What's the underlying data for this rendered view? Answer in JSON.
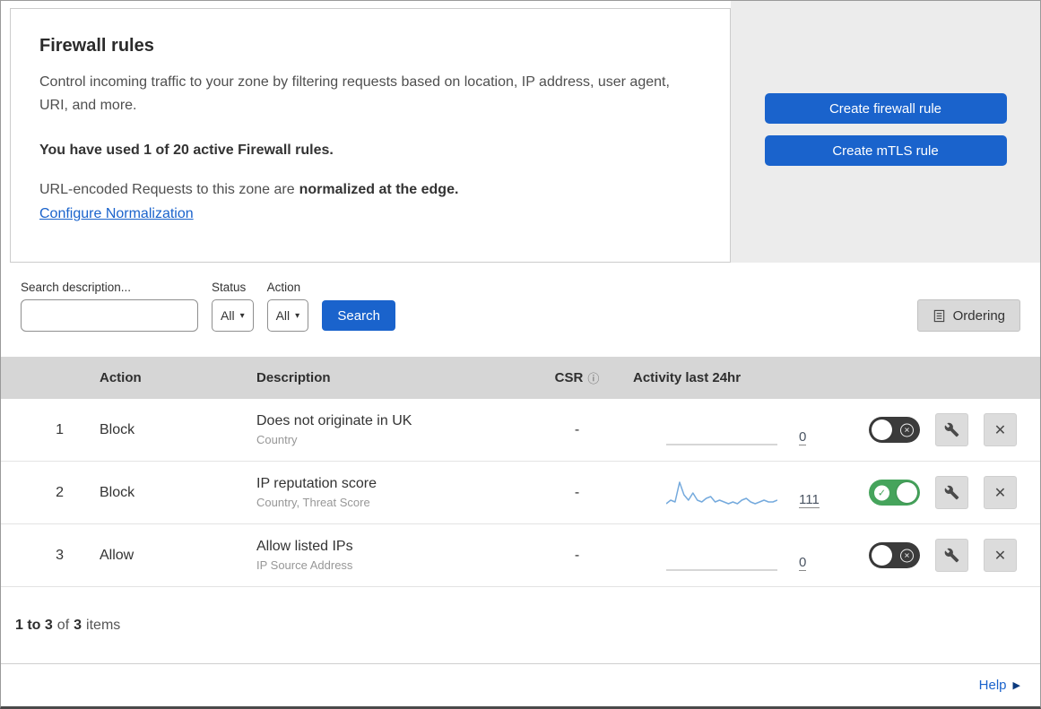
{
  "page": {
    "title": "Firewall rules",
    "description": "Control incoming traffic to your zone by filtering requests based on location, IP address, user agent, URI, and more.",
    "usage_text": "You have used 1 of 20 active Firewall rules.",
    "normalization_prefix": "URL-encoded Requests to this zone are",
    "normalization_bold": "normalized at the edge.",
    "normalization_link": "Configure Normalization"
  },
  "actions_panel": {
    "create_firewall_rule": "Create firewall rule",
    "create_mtls_rule": "Create mTLS rule"
  },
  "toolbar": {
    "search_label": "Search description...",
    "status": {
      "label": "Status",
      "value": "All"
    },
    "action": {
      "label": "Action",
      "value": "All"
    },
    "search_button": "Search",
    "ordering_button": "Ordering"
  },
  "table": {
    "headers": {
      "action": "Action",
      "description": "Description",
      "csr": "CSR",
      "activity": "Activity last 24hr"
    },
    "rows": [
      {
        "priority": "1",
        "action": "Block",
        "description": "Does not originate in UK",
        "match_fields": "Country",
        "csr": "-",
        "activity_count": "0",
        "enabled": false,
        "sparkline": [
          0,
          0,
          0,
          0,
          0,
          0,
          0,
          0,
          0,
          0,
          0,
          0
        ]
      },
      {
        "priority": "2",
        "action": "Block",
        "description": "IP reputation score",
        "match_fields": "Country, Threat Score",
        "csr": "-",
        "activity_count": "111",
        "enabled": true,
        "sparkline": [
          2,
          4,
          3,
          14,
          7,
          4,
          8,
          4,
          3,
          5,
          6,
          3,
          4,
          3,
          2,
          3,
          2,
          4,
          5,
          3,
          2,
          3,
          4,
          3,
          3,
          4
        ]
      },
      {
        "priority": "3",
        "action": "Allow",
        "description": "Allow listed IPs",
        "match_fields": "IP Source Address",
        "csr": "-",
        "activity_count": "0",
        "enabled": false,
        "sparkline": [
          0,
          0,
          0,
          0,
          0,
          0,
          0,
          0,
          0,
          0,
          0,
          0
        ]
      }
    ]
  },
  "footer": {
    "range": "1 to 3",
    "of": "of",
    "total": "3",
    "items": "items",
    "help": "Help"
  },
  "icons": {
    "check": "✓",
    "close": "✕",
    "caret_down": "▾",
    "info": "ⓘ",
    "help_arrow": "▶"
  },
  "colors": {
    "accent_blue": "#1a63cc",
    "toggle_on_green": "#46a45c",
    "toggle_off_dark": "#3b3b3b",
    "sparkline_blue": "#75aadd",
    "sparkline_flat": "#c9c9c9",
    "table_header_bg": "#d6d6d6"
  }
}
